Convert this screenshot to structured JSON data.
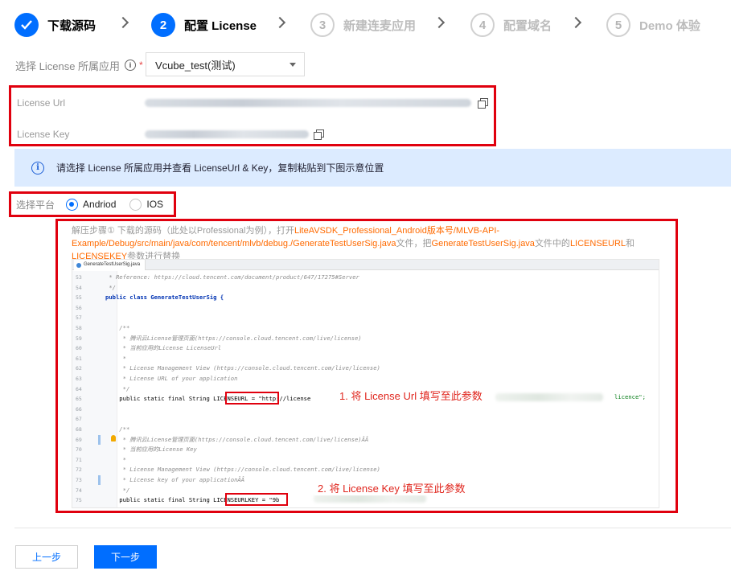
{
  "stepper": {
    "steps": [
      {
        "number": "",
        "label": "下载源码",
        "state": "done"
      },
      {
        "number": "2",
        "label": "配置 License",
        "state": "active"
      },
      {
        "number": "3",
        "label": "新建连麦应用",
        "state": "todo"
      },
      {
        "number": "4",
        "label": "配置域名",
        "state": "todo"
      },
      {
        "number": "5",
        "label": "Demo 体验",
        "state": "todo"
      }
    ]
  },
  "app_select": {
    "label": "选择 License 所属应用",
    "required_mark": "*",
    "value": "Vcube_test(测试)"
  },
  "license": {
    "url_label": "License Url",
    "key_label": "License Key"
  },
  "banner": {
    "text": "请选择 License 所属应用并查看 LicenseUrl & Key，复制粘贴到下图示意位置"
  },
  "platform": {
    "label": "选择平台",
    "options": [
      {
        "label": "Andriod",
        "selected": true
      },
      {
        "label": "IOS",
        "selected": false
      }
    ]
  },
  "instructions": {
    "part1": "解压步骤① 下载的源码（此处以Professional为例），打开",
    "path": "LiteAVSDK_Professional_Android版本号/MLVB-API-Example/Debug/src/main/java/com/tencent/mlvb/debug./GenerateTestUserSig.java",
    "part2": "文件，把",
    "file": "GenerateTestUserSig.java",
    "part3": "文件中的",
    "key1": "LICENSEURL",
    "part4": "和",
    "key2": "LICENSEKEY",
    "part5": "参数进行替换"
  },
  "code": {
    "tab": "GenerateTestUserSig.java",
    "lines": [
      {
        "n": "53",
        "t": " * Reference: https://cloud.tencent.com/document/product/647/17275#Server",
        "c": "cmt"
      },
      {
        "n": "54",
        "t": " */",
        "c": "cmt"
      },
      {
        "n": "55",
        "t": "public class GenerateTestUserSig {",
        "c": "decl"
      },
      {
        "n": "56",
        "t": "",
        "c": ""
      },
      {
        "n": "57",
        "t": "",
        "c": ""
      },
      {
        "n": "58",
        "t": "    /**",
        "c": "cmt"
      },
      {
        "n": "59",
        "t": "     * 腾讯云License管理页面(https://console.cloud.tencent.com/live/license)",
        "c": "cmt"
      },
      {
        "n": "60",
        "t": "     * 当前应用的License LicenseUrl",
        "c": "cmt"
      },
      {
        "n": "61",
        "t": "     *",
        "c": "cmt"
      },
      {
        "n": "62",
        "t": "     * License Management View (https://console.cloud.tencent.com/live/license)",
        "c": "cmt"
      },
      {
        "n": "63",
        "t": "     * License URL of your application",
        "c": "cmt"
      },
      {
        "n": "64",
        "t": "     */",
        "c": "cmt"
      },
      {
        "n": "65",
        "t": "    public static final String LICENSEURL = \"http://license",
        "c": "url"
      },
      {
        "n": "66",
        "t": "",
        "c": ""
      },
      {
        "n": "67",
        "t": "",
        "c": ""
      },
      {
        "n": "68",
        "t": "    /**",
        "c": "cmt"
      },
      {
        "n": "69",
        "t": "     * 腾讯云License管理页面(https://console.cloud.tencent.com/live/license)ÂÂ",
        "c": "cmt"
      },
      {
        "n": "70",
        "t": "     * 当前应用的License Key",
        "c": "cmt"
      },
      {
        "n": "71",
        "t": "     *",
        "c": "cmt"
      },
      {
        "n": "72",
        "t": "     * License Management View (https://console.cloud.tencent.com/live/license)",
        "c": "cmt"
      },
      {
        "n": "73",
        "t": "     * License key of your applicationÂÂ",
        "c": "cmt"
      },
      {
        "n": "74",
        "t": "     */",
        "c": "cmt"
      },
      {
        "n": "75",
        "t": "    public static final String LICENSEURLKEY = \"9b",
        "c": "key"
      }
    ],
    "url_tail": "licence\";",
    "annotation1": "1. 将 License Url 填写至此参数",
    "annotation2": "2. 将 License Key 填写至此参数"
  },
  "footer": {
    "prev_label": "上一步",
    "next_label": "下一步"
  },
  "colors": {
    "primary": "#006eff",
    "highlight_red": "#e0000e",
    "orange_text": "#ff6a00",
    "banner_bg": "#dcebff"
  }
}
